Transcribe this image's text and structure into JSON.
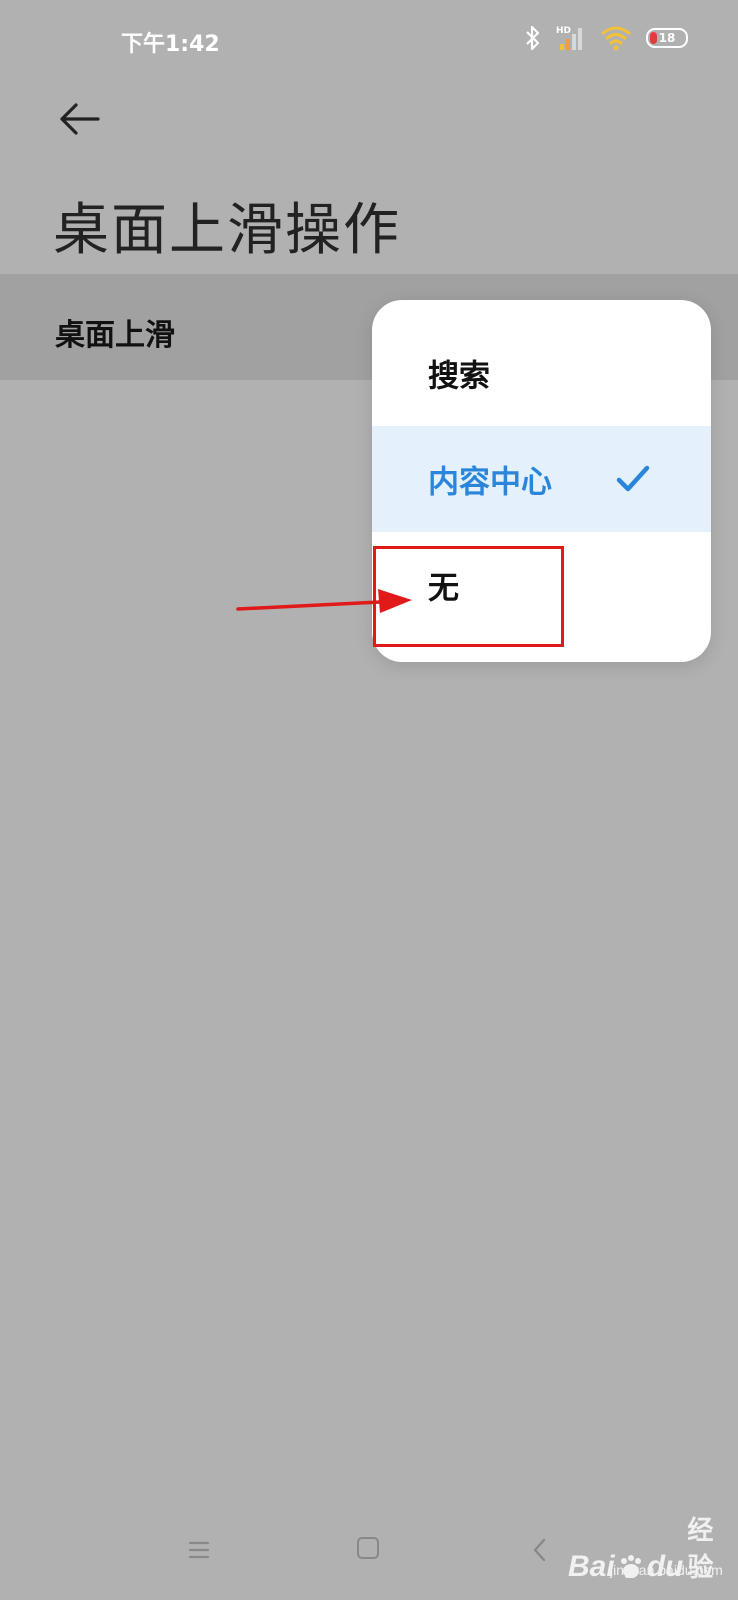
{
  "status_bar": {
    "time": "下午1:42",
    "hd_label": "HD",
    "battery_level": "18",
    "icons": [
      "bluetooth-icon",
      "signal-icon",
      "wifi-icon",
      "battery-icon"
    ]
  },
  "header": {
    "back_icon": "arrow-left-icon",
    "title": "桌面上滑操作"
  },
  "setting_row": {
    "label": "桌面上滑"
  },
  "dropdown": {
    "options": [
      {
        "label": "搜索",
        "selected": false
      },
      {
        "label": "内容中心",
        "selected": true
      },
      {
        "label": "无",
        "selected": false
      }
    ],
    "selected_color": "#2a86db",
    "selected_bg": "#e4f0fc"
  },
  "annotation": {
    "color": "#e01919",
    "highlighted_option": "无"
  },
  "nav_bar": {
    "icons": [
      "menu-icon",
      "home-icon",
      "back-icon"
    ]
  },
  "watermark": {
    "logo_text_1": "Bai",
    "logo_text_2": "du",
    "logo_text_3": "经验",
    "url": "jingyan.baidu.com"
  }
}
